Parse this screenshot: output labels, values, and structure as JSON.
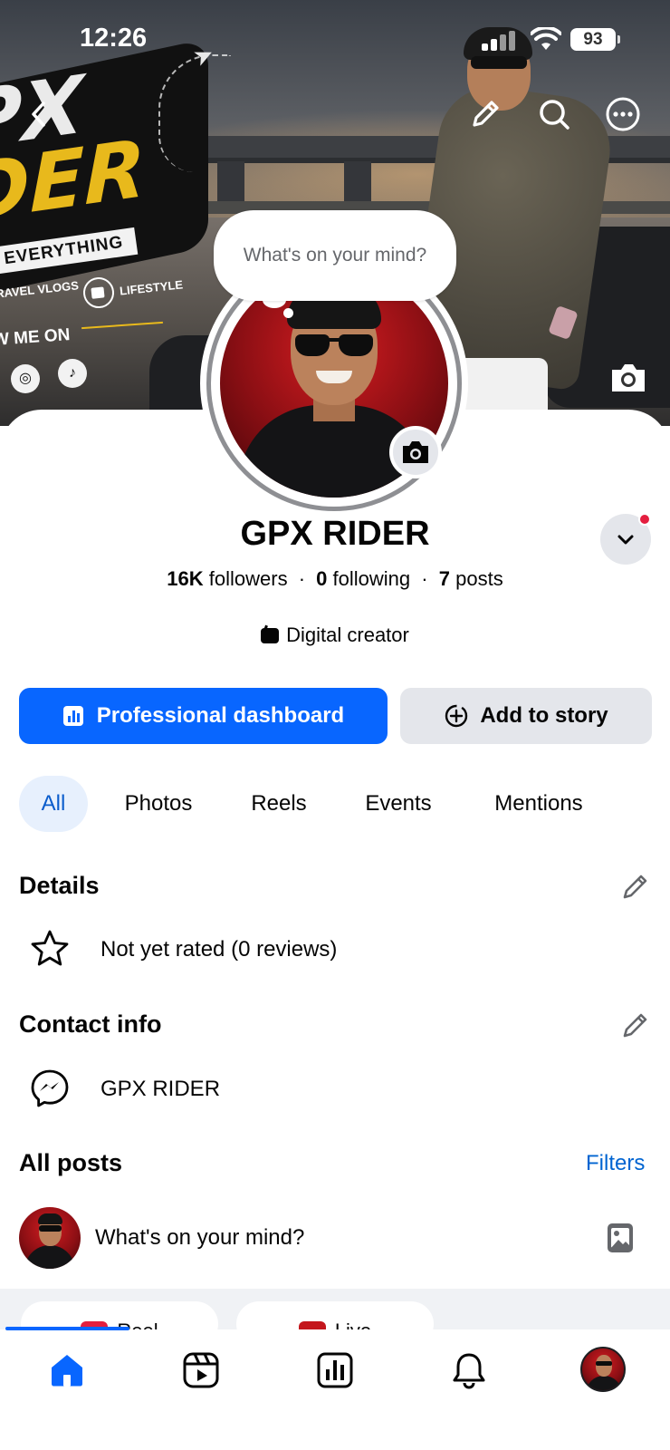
{
  "status_bar": {
    "time": "12:26",
    "battery": "93"
  },
  "cover": {
    "brand_line1": "PX",
    "brand_line2": "DER",
    "tagline": "EVERYTHING",
    "vlogs_label": "RAVEL VLOGS",
    "lifestyle_label": "LIFESTYLE",
    "follow_label": "W ME ON"
  },
  "thought_bubble": {
    "text": "What's on your mind?"
  },
  "profile": {
    "name": "GPX RIDER",
    "followers_count": "16K",
    "followers_label": "followers",
    "following_count": "0",
    "following_label": "following",
    "posts_count": "7",
    "posts_label": "posts",
    "category": "Digital creator"
  },
  "actions": {
    "dashboard_label": "Professional dashboard",
    "story_label": "Add to story"
  },
  "tabs": [
    {
      "label": "All",
      "active": true
    },
    {
      "label": "Photos",
      "active": false
    },
    {
      "label": "Reels",
      "active": false
    },
    {
      "label": "Events",
      "active": false
    },
    {
      "label": "Mentions",
      "active": false
    }
  ],
  "details": {
    "title": "Details",
    "rating_text": "Not yet rated (0 reviews)"
  },
  "contact": {
    "title": "Contact info",
    "messenger_name": "GPX RIDER"
  },
  "posts": {
    "title": "All posts",
    "filters_label": "Filters",
    "composer_placeholder": "What's on your mind?"
  },
  "create_pills": [
    {
      "label": "Reel",
      "icon": "reel-icon"
    },
    {
      "label": "Live",
      "icon": "live-icon"
    }
  ],
  "bottom_nav": [
    {
      "name": "home",
      "icon": "home-icon",
      "active": true
    },
    {
      "name": "video",
      "icon": "video-icon",
      "active": false
    },
    {
      "name": "dashboard",
      "icon": "dashboard-icon",
      "active": false
    },
    {
      "name": "notifications",
      "icon": "bell-icon",
      "active": false
    },
    {
      "name": "profile",
      "icon": "avatar-icon",
      "active": false
    }
  ],
  "colors": {
    "accent": "#0866ff",
    "link": "#0064d1",
    "tab_active_bg": "#e7f0fd",
    "secondary_bg": "#e4e6eb",
    "notification_dot": "#e41e3f"
  }
}
